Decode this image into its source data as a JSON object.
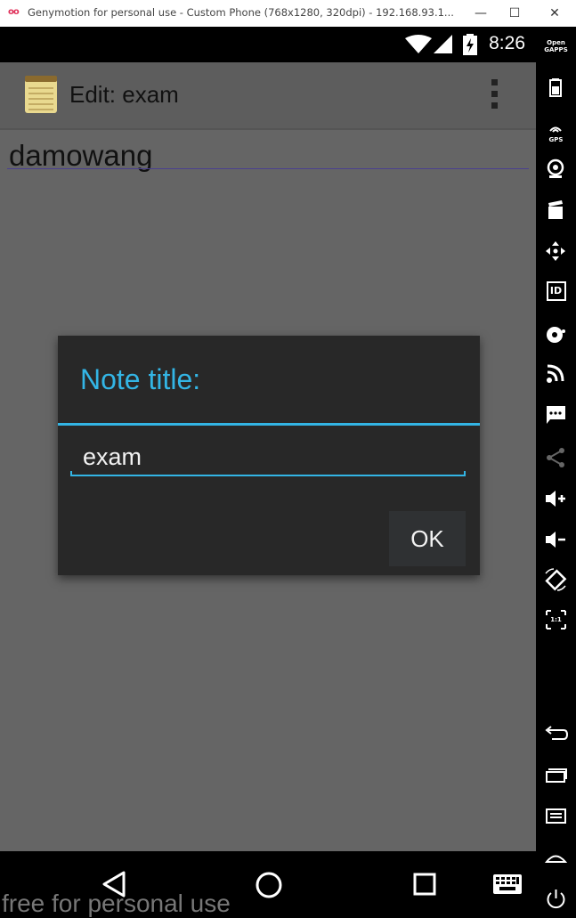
{
  "window": {
    "logo": "oo",
    "title": "Genymotion for personal use - Custom Phone (768x1280, 320dpi) - 192.168.93.1...",
    "minimize": "—",
    "maximize": "☐",
    "close": "✕"
  },
  "statusbar": {
    "time": "8:26"
  },
  "actionbar": {
    "title": "Edit: exam"
  },
  "note": {
    "text": "damowang"
  },
  "dialog": {
    "title": "Note title:",
    "input_value": "exam",
    "ok_label": "OK"
  },
  "watermark": "free for personal use",
  "sidebar": {
    "opengapps_top": "Open",
    "opengapps_bottom": "GAPPS",
    "gps_label": "GPS",
    "id_label": "ID",
    "ratio_label": "1:1"
  }
}
